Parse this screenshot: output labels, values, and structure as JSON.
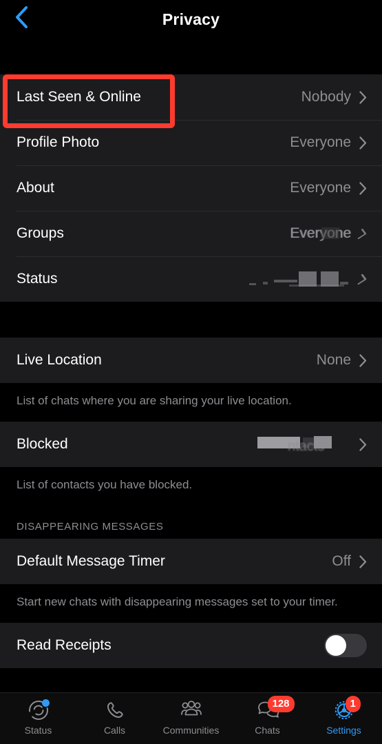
{
  "header": {
    "title": "Privacy",
    "back_icon": "chevron-left-icon"
  },
  "annotation": {
    "target": "Last Seen & Online",
    "color": "#ff3b30"
  },
  "sections": [
    {
      "name": "visibility",
      "rows": [
        {
          "label": "Last Seen & Online",
          "value": "Nobody",
          "type": "disclosure",
          "highlighted": true
        },
        {
          "label": "Profile Photo",
          "value": "Everyone",
          "type": "disclosure"
        },
        {
          "label": "About",
          "value": "Everyone",
          "type": "disclosure"
        },
        {
          "label": "Groups",
          "value": "Everyone",
          "type": "disclosure",
          "glitched": true
        },
        {
          "label": "Status",
          "value": "",
          "type": "disclosure",
          "glitched": true
        }
      ]
    },
    {
      "name": "live-location",
      "rows": [
        {
          "label": "Live Location",
          "value": "None",
          "type": "disclosure"
        }
      ],
      "footer": "List of chats where you are sharing your live location."
    },
    {
      "name": "blocked",
      "rows": [
        {
          "label": "Blocked",
          "value": "ntacts",
          "type": "disclosure",
          "glitched": true
        }
      ],
      "footer": "List of contacts you have blocked."
    },
    {
      "name": "disappearing-messages",
      "header": "DISAPPEARING MESSAGES",
      "rows": [
        {
          "label": "Default Message Timer",
          "value": "Off",
          "type": "disclosure"
        }
      ],
      "footer": "Start new chats with disappearing messages set to your timer."
    },
    {
      "name": "read-receipts",
      "rows": [
        {
          "label": "Read Receipts",
          "value": "",
          "type": "toggle",
          "toggle_on": false
        }
      ]
    }
  ],
  "tabbar": {
    "items": [
      {
        "label": "Status",
        "icon": "status-ring-icon",
        "active": false,
        "dot": true
      },
      {
        "label": "Calls",
        "icon": "phone-icon",
        "active": false
      },
      {
        "label": "Communities",
        "icon": "communities-icon",
        "active": false
      },
      {
        "label": "Chats",
        "icon": "chat-bubbles-icon",
        "active": false,
        "badge": "128"
      },
      {
        "label": "Settings",
        "icon": "gear-icon",
        "active": true,
        "badge": "1"
      }
    ]
  },
  "colors": {
    "accent": "#2f9bf6",
    "badge": "#ff3b30",
    "row_bg": "#1c1c1e",
    "page_bg": "#000000",
    "secondary_text": "#8e8e93"
  }
}
